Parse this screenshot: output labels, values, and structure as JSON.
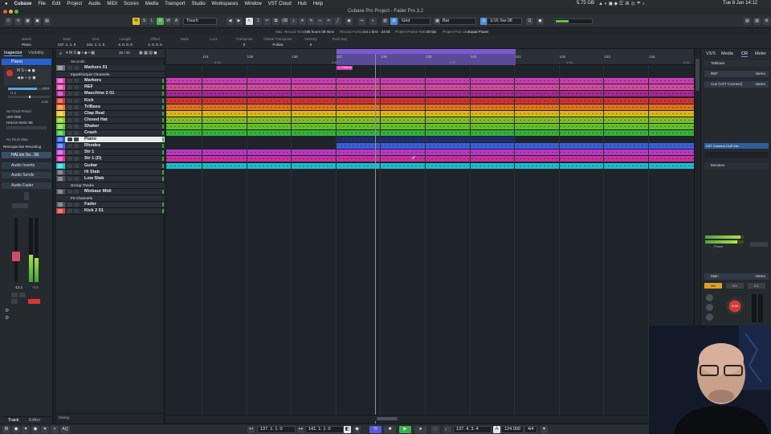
{
  "menubar": {
    "items": [
      "Cubase",
      "File",
      "Edit",
      "Project",
      "Audio",
      "MIDI",
      "Scores",
      "Media",
      "Transport",
      "Studio",
      "Workspaces",
      "Window",
      "VST Cloud",
      "Hub",
      "Help"
    ],
    "memory": "5.75 GB",
    "clock": "Tue 8 Jun 14:12"
  },
  "window_title": "Cubase Pro Project - Fader Pro 3.2",
  "toolbar": {
    "automation_mode": "Touch",
    "snap_type": "Grid",
    "grid_type": "Bar",
    "quantize": "1/16 Sw-38",
    "msrwa": [
      "M",
      "S",
      "L",
      "R",
      "W",
      "A"
    ]
  },
  "statusline": {
    "max_record_time_label": "Max. Record Time",
    "max_record_time": "195 hours 08 mins",
    "record_format_label": "Record Format",
    "record_format": "44.1 kHz - 24 bit",
    "frame_rate_label": "Project Frame Rate",
    "frame_rate": "30 fps",
    "pan_law_label": "Project Pan Law",
    "pan_law": "Equal Power"
  },
  "infoline": {
    "columns": [
      {
        "label": "Name",
        "value": "Piano"
      },
      {
        "label": "Start",
        "value": "137. 1. 1. 0"
      },
      {
        "label": "End",
        "value": "141. 1. 1. 0"
      },
      {
        "label": "Length",
        "value": "4. 0. 0. 0"
      },
      {
        "label": "Offset",
        "value": "1. 0. 0. 0"
      },
      {
        "label": "Mute",
        "value": ""
      },
      {
        "label": "Lock",
        "value": ""
      },
      {
        "label": "Transpose",
        "value": "0"
      },
      {
        "label": "Global Transpose",
        "value": "Follow"
      },
      {
        "label": "Velocity",
        "value": "0"
      },
      {
        "label": "Root Key",
        "value": ""
      }
    ]
  },
  "inspector": {
    "tabs": [
      "Inspector",
      "Visibility"
    ],
    "track_name": "Piano",
    "input_label": "No Track Preset",
    "midi_in": "UMI ONE",
    "instrument": "HALion Sonic SE",
    "midi_port": "No Drum Map",
    "retro_record": "Retrospective Recording",
    "instrument_slot": "HALion So...SE",
    "sections": [
      "Audio Inserts",
      "Audio Sends",
      "Audio Fader"
    ],
    "fader_value": "-13.1",
    "fader_pan": "-0.5",
    "vol_value": "-13.1",
    "pan_value": "0.00",
    "bottom_tabs": [
      "Track",
      "Editor"
    ]
  },
  "tracklist": {
    "header_time_format": "Seconds",
    "zoom": "36 / 36",
    "footer_label": "Mixing",
    "tracks": [
      {
        "name": "Markers 01",
        "kind": "marker",
        "color": "#6b7078"
      },
      {
        "name": "Input/Output Channels",
        "kind": "folder",
        "color": "#2a2f35"
      },
      {
        "name": "Markers",
        "kind": "midi",
        "color": "#d83fbf"
      },
      {
        "name": "REF",
        "kind": "audio",
        "color": "#e04fa0"
      },
      {
        "name": "Maschine 2 01",
        "kind": "audio",
        "color": "#b1289c"
      },
      {
        "name": "Kick",
        "kind": "audio",
        "color": "#e0323a"
      },
      {
        "name": "TrlBass",
        "kind": "audio",
        "color": "#ef7a1e"
      },
      {
        "name": "Clap Real",
        "kind": "audio",
        "color": "#ecc21d"
      },
      {
        "name": "Closed Hat",
        "kind": "audio",
        "color": "#8acb25"
      },
      {
        "name": "Shaker",
        "kind": "audio",
        "color": "#6ccc2a"
      },
      {
        "name": "Crash",
        "kind": "audio",
        "color": "#38bd3b"
      },
      {
        "name": "Piano",
        "kind": "instrument",
        "color": "#2453d6"
      },
      {
        "name": "Rhodes",
        "kind": "instrument",
        "color": "#3b66e8"
      },
      {
        "name": "Str 1",
        "kind": "instrument",
        "color": "#c43ad0"
      },
      {
        "name": "Str 1 (D)",
        "kind": "instrument",
        "color": "#d82fa8"
      },
      {
        "name": "Guitar",
        "kind": "audio",
        "color": "#1fc8d9"
      },
      {
        "name": "Hi Stab",
        "kind": "audio",
        "color": "#4a5058"
      },
      {
        "name": "Low Stab",
        "kind": "audio",
        "color": "#4a5058"
      },
      {
        "name": "Group Tracks",
        "kind": "folder",
        "color": "#2a2f35"
      },
      {
        "name": "Mixbaur Midi",
        "kind": "audio",
        "color": "#4a5058"
      },
      {
        "name": "FX Channels",
        "kind": "folder",
        "color": "#2a2f35"
      },
      {
        "name": "Fader",
        "kind": "audio",
        "color": "#4a5058"
      },
      {
        "name": "Kick 2 01",
        "kind": "audio",
        "color": "#d04040"
      }
    ]
  },
  "ruler": {
    "bars": [
      "134",
      "135",
      "136",
      "137",
      "138",
      "139",
      "140",
      "141",
      "142",
      "143",
      "144"
    ],
    "seconds": [
      "3:30",
      "3:45",
      "4:00",
      "4:15",
      "4:30"
    ],
    "marker_clip": "1. Chorus"
  },
  "right_zone": {
    "tabs": [
      "VSTi",
      "Media",
      "CR",
      "Meter"
    ],
    "talkback": "Talkback",
    "outputs": [
      {
        "name": "REF",
        "format": "stereo"
      },
      {
        "name": "Cue (VST Connect)",
        "format": "stereo"
      }
    ],
    "cue_mix_label": "VST Connect CUE Mix",
    "monitors_label": "Monitors",
    "main_label": "Main",
    "main_format": "stereo",
    "main_value": "0.00",
    "cr_values": [
      "Mix",
      "0.1",
      "0.1"
    ],
    "phase_label": "Phase"
  },
  "transport": {
    "left_locator": "137. 1. 1. 0",
    "right_locator": "141. 1. 1. 0",
    "position": "137. 4. 3. 4",
    "tempo": "124.000",
    "signature": "4/4",
    "punch_label": "AQ"
  }
}
